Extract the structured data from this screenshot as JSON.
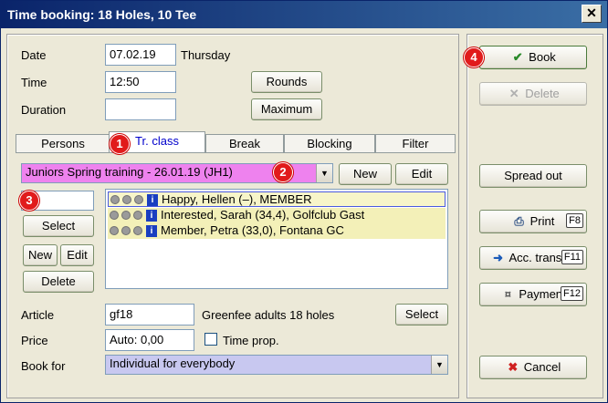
{
  "window": {
    "title": "Time booking: 18 Holes, 10 Tee",
    "close_glyph": "✕"
  },
  "form": {
    "date_label": "Date",
    "date_value": "07.02.19",
    "weekday": "Thursday",
    "time_label": "Time",
    "time_value": "12:50",
    "duration_label": "Duration",
    "duration_value": "",
    "rounds_label": "Rounds",
    "maximum_label": "Maximum"
  },
  "tabs": [
    {
      "label": "Persons"
    },
    {
      "label": "Tr. class",
      "active": true
    },
    {
      "label": "Break"
    },
    {
      "label": "Blocking"
    },
    {
      "label": "Filter"
    }
  ],
  "class": {
    "selected": "Juniors Spring training - 26.01.19 (JH1)",
    "new_label": "New",
    "edit_label": "Edit"
  },
  "persons": {
    "search_value": "",
    "select_label": "Select",
    "new_label": "New",
    "edit_label": "Edit",
    "delete_label": "Delete",
    "rows": [
      "Happy, Hellen (–), MEMBER",
      "Interested, Sarah (34,4), Golfclub Gast",
      "Member, Petra (33,0), Fontana GC"
    ]
  },
  "article": {
    "label": "Article",
    "value": "gf18",
    "description": "Greenfee adults 18 holes",
    "select_label": "Select"
  },
  "price": {
    "label": "Price",
    "value": "Auto: 0,00",
    "time_prop_label": "Time prop."
  },
  "book_for": {
    "label": "Book for",
    "value": "Individual for everybody"
  },
  "actions": {
    "book": "Book",
    "delete": "Delete",
    "spread_out": "Spread out",
    "print": "Print",
    "print_key": "F8",
    "acc_transfer": "Acc. transfer",
    "acc_transfer_key": "F11",
    "payment": "Payment",
    "payment_key": "F12",
    "cancel": "Cancel"
  },
  "badges": [
    "1",
    "2",
    "3",
    "4"
  ],
  "colors": {
    "title_bar": "#0a246a",
    "class_select_bg": "#ee82ee",
    "book_for_bg": "#c8c8f0",
    "badge": "#e11b1b",
    "list_row": "#f3f0b8"
  }
}
